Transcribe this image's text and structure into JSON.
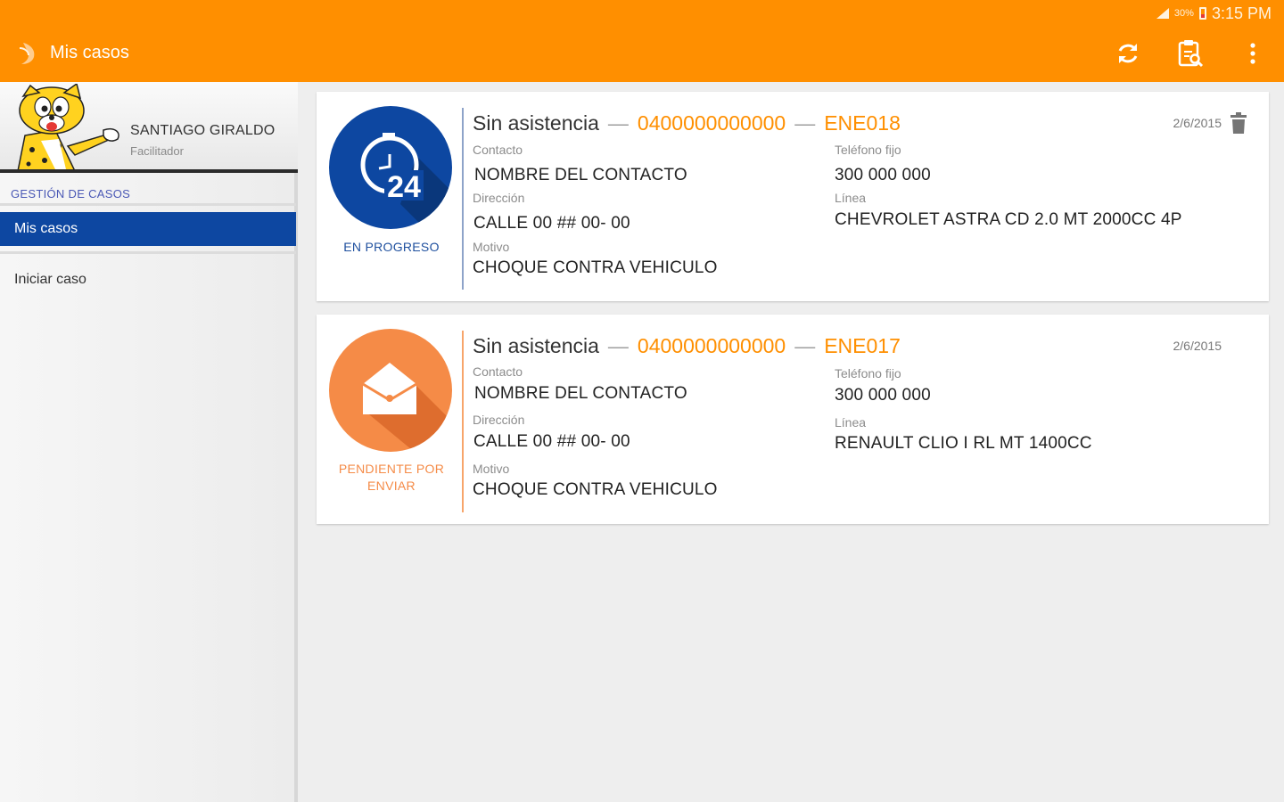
{
  "status_bar": {
    "battery": "30%",
    "time": "3:15 PM"
  },
  "app_bar": {
    "title": "Mis casos",
    "actions": [
      "refresh-icon",
      "clipboard-icon",
      "more-vert-icon"
    ]
  },
  "drawer": {
    "user_name": "SANTIAGO GIRALDO",
    "user_role": "Facilitador",
    "section_label": "GESTIÓN DE CASOS",
    "items": [
      {
        "label": "Mis casos",
        "active": true
      },
      {
        "label": "Iniciar caso",
        "active": false
      }
    ]
  },
  "cases": [
    {
      "status": "EN PROGRESO",
      "status_icon": "clock-24-icon",
      "status_color": "#0d47a1",
      "title": "Sin asistencia",
      "number": "0400000000000",
      "code": "ENE018",
      "date": "2/6/2015",
      "deletable": true,
      "contact_label": "Contacto",
      "contact": "NOMBRE DEL CONTACTO",
      "address_label": "Dirección",
      "address": "CALLE 00 ## 00- 00",
      "reason_label": "Motivo",
      "reason": "CHOQUE CONTRA VEHICULO",
      "phone_label": "Teléfono fijo",
      "phone": "300 000 000",
      "line_label": "Línea",
      "line": "CHEVROLET ASTRA CD 2.0 MT 2000CC 4P"
    },
    {
      "status": "PENDIENTE POR ENVIAR",
      "status_icon": "envelope-icon",
      "status_color": "#f58b47",
      "title": "Sin asistencia",
      "number": "0400000000000",
      "code": "ENE017",
      "date": "2/6/2015",
      "deletable": false,
      "contact_label": "Contacto",
      "contact": "NOMBRE DEL CONTACTO",
      "address_label": "Dirección",
      "address": "CALLE 00 ## 00- 00",
      "reason_label": "Motivo",
      "reason": "CHOQUE CONTRA VEHICULO",
      "phone_label": "Teléfono fijo",
      "phone": "300 000 000",
      "line_label": "Línea",
      "line": "RENAULT CLIO I RL MT 1400CC"
    }
  ],
  "colors": {
    "primary": "#ff8f00",
    "accent": "#0d47a1"
  }
}
